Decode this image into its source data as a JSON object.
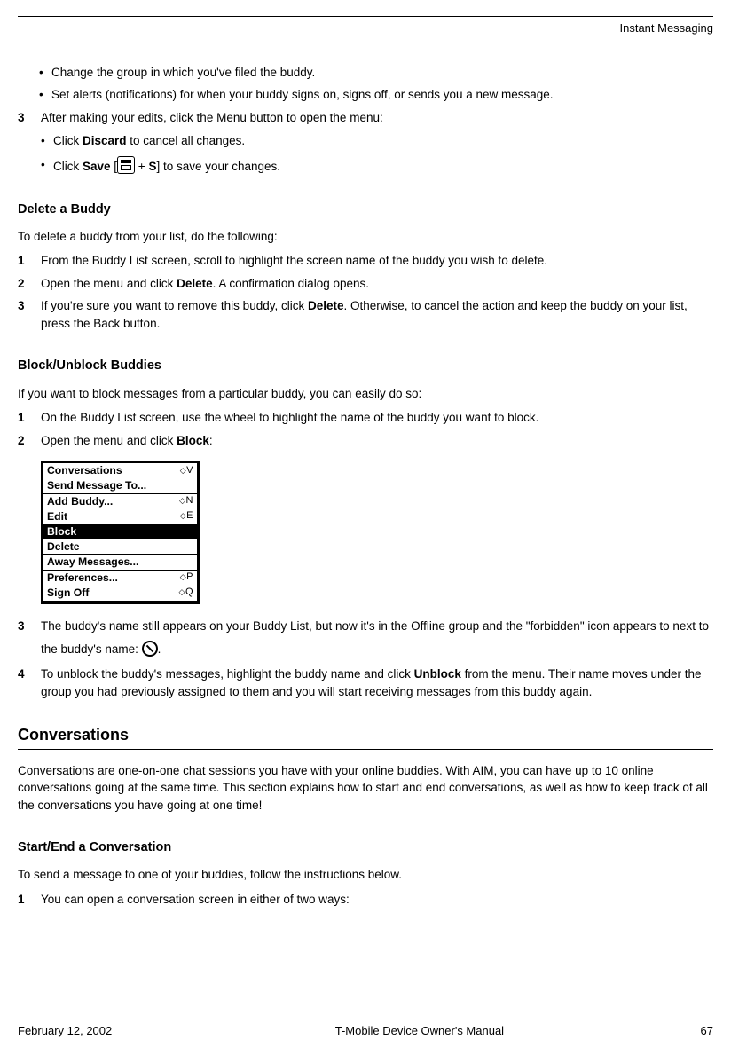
{
  "running_head": "Instant Messaging",
  "intro_bullets": [
    "Change the group in which you've filed the buddy.",
    "Set alerts (notifications) for when your buddy signs on, signs off, or sends you a new message."
  ],
  "step3": {
    "num": "3",
    "text": "After making your edits, click the Menu button to open the menu:",
    "b1_pre": "Click ",
    "b1_bold": "Discard",
    "b1_post": " to cancel all changes.",
    "b2_pre": "Click ",
    "b2_bold": "Save",
    "b2_mid": " [",
    "b2_plus": " + ",
    "b2_s": "S",
    "b2_post": "] to save your changes."
  },
  "delete": {
    "heading": "Delete a Buddy",
    "intro": "To delete a buddy from your list, do the following:",
    "s1": {
      "num": "1",
      "text": "From the Buddy List screen, scroll to highlight the screen name of the buddy you wish to delete."
    },
    "s2": {
      "num": "2",
      "pre": "Open the menu and click ",
      "bold": "Delete",
      "post": ". A confirmation dialog opens."
    },
    "s3": {
      "num": "3",
      "pre": "If you're sure you want to remove this buddy, click ",
      "bold": "Delete",
      "post": ". Otherwise, to cancel the action and keep the buddy on your list, press the Back button."
    }
  },
  "block": {
    "heading": "Block/Unblock Buddies",
    "intro": "If you want to block messages from a particular buddy, you can easily do so:",
    "s1": {
      "num": "1",
      "text": "On the Buddy List screen, use the wheel to highlight the name of the buddy you want to block."
    },
    "s2": {
      "num": "2",
      "pre": "Open the menu and click ",
      "bold": "Block",
      "post": ":"
    },
    "menu": {
      "items": [
        {
          "label": "Conversations",
          "sc": "V",
          "sep": false,
          "sel": false
        },
        {
          "label": "Send Message To...",
          "sc": "",
          "sep": true,
          "sel": false
        },
        {
          "label": "Add Buddy...",
          "sc": "N",
          "sep": false,
          "sel": false
        },
        {
          "label": "Edit",
          "sc": "E",
          "sep": false,
          "sel": false
        },
        {
          "label": "Block",
          "sc": "",
          "sep": false,
          "sel": true
        },
        {
          "label": "Delete",
          "sc": "",
          "sep": true,
          "sel": false
        },
        {
          "label": "Away Messages...",
          "sc": "",
          "sep": true,
          "sel": false
        },
        {
          "label": "Preferences...",
          "sc": "P",
          "sep": false,
          "sel": false
        },
        {
          "label": "Sign Off",
          "sc": "Q",
          "sep": false,
          "sel": false
        }
      ]
    },
    "s3": {
      "num": "3",
      "pre": "The buddy's name still appears on your Buddy List, but now it's in the Offline group and the \"forbidden\" icon appears to next to the buddy's name:  ",
      "post": "."
    },
    "s4": {
      "num": "4",
      "pre": "To unblock the buddy's messages, highlight the buddy name and click ",
      "bold": "Unblock",
      "post": " from the menu. Their name moves under the group you had previously assigned to them and you will start receiving messages from this buddy again."
    }
  },
  "conv": {
    "heading": "Conversations",
    "para": "Conversations are one-on-one chat sessions you have with your online buddies. With AIM, you can have up to 10 online conversations going at the same time. This section explains how to start and end conversations, as well as how to keep track of all the conversations you have going at one time!",
    "sub": "Start/End a Conversation",
    "intro": "To send a message to one of your buddies, follow the instructions below.",
    "s1": {
      "num": "1",
      "text": "You can open a conversation screen in either of two ways:"
    }
  },
  "footer": {
    "date": "February 12, 2002",
    "title": "T-Mobile Device Owner's Manual",
    "page": "67"
  }
}
